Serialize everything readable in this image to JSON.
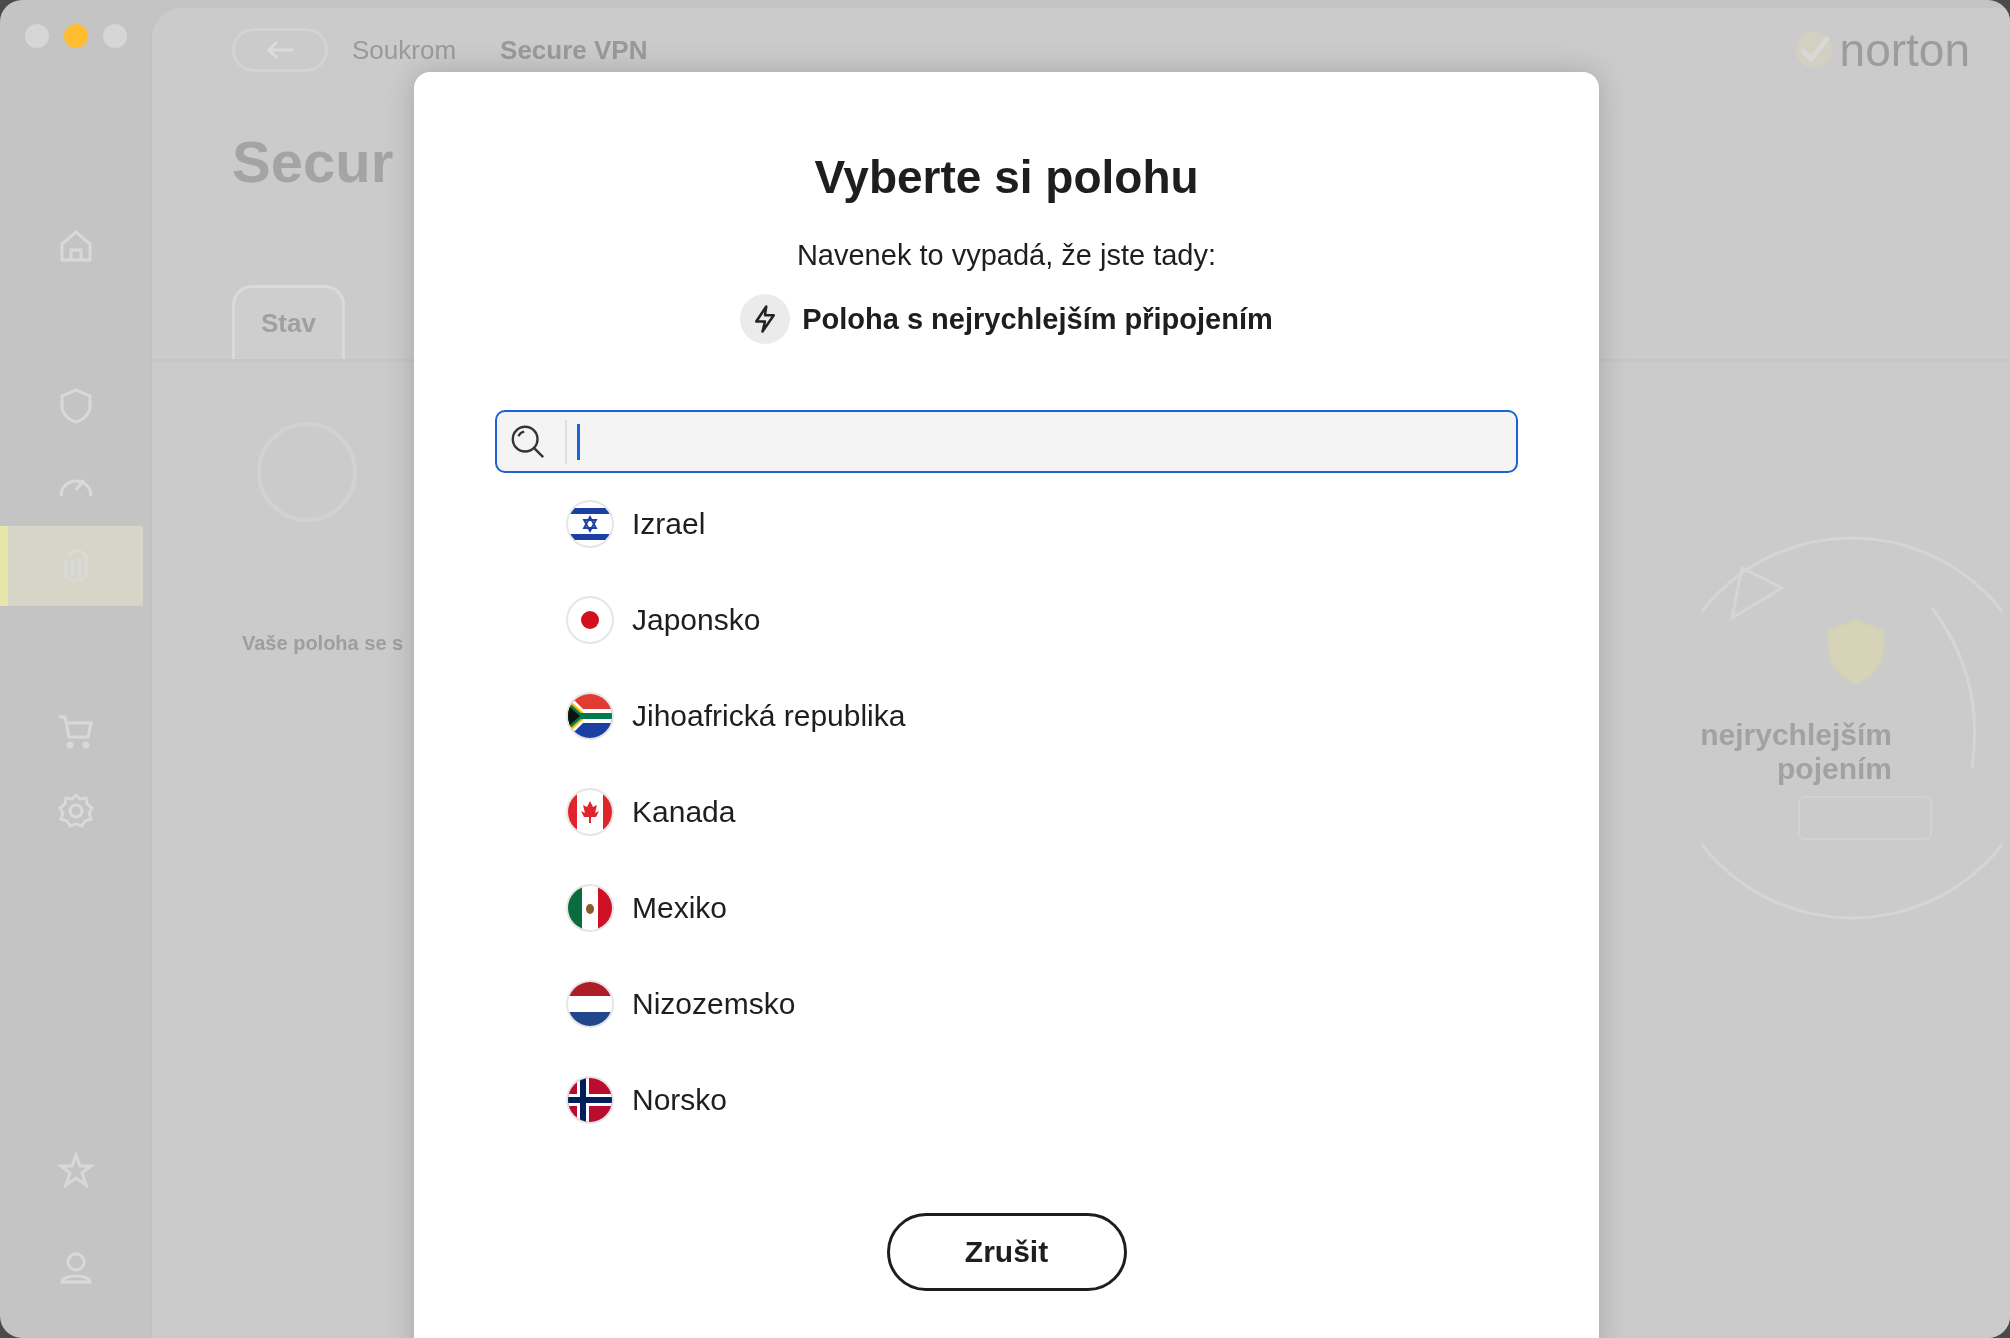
{
  "window": {
    "traffic_lights": [
      {
        "color": "#d6d6d6"
      },
      {
        "color": "#febc2e"
      },
      {
        "color": "#d6d6d6"
      }
    ]
  },
  "sidebar": {
    "items": [
      {
        "selected": false
      },
      {
        "selected": false
      },
      {
        "selected": false
      },
      {
        "selected": true
      },
      {
        "selected": false
      },
      {
        "selected": false
      },
      {
        "selected": false
      },
      {
        "selected": false
      }
    ]
  },
  "header": {
    "breadcrumb": [
      "Soukrom",
      "Secure VPN"
    ],
    "logo": "norton"
  },
  "page": {
    "title": "Secur",
    "tabs": [
      {
        "label": "Stav",
        "selected": true
      }
    ],
    "location_label": "Vaše poloha se s",
    "status_lines": [
      "nejrychlejším",
      "pojením"
    ]
  },
  "dialog": {
    "title": "Vyberte si polohu",
    "subtitle": "Navenek to vypadá, že jste tady:",
    "current_location": "Poloha s nejrychlejším připojením",
    "search": {
      "focused": true
    },
    "locations": [
      {
        "name": "Izrael"
      },
      {
        "name": "Japonsko"
      },
      {
        "name": "Jihoafrická republika"
      },
      {
        "name": "Kanada"
      },
      {
        "name": "Mexiko"
      },
      {
        "name": "Nizozemsko"
      },
      {
        "name": "Norsko"
      }
    ],
    "cancel_button": "Zrušit"
  }
}
